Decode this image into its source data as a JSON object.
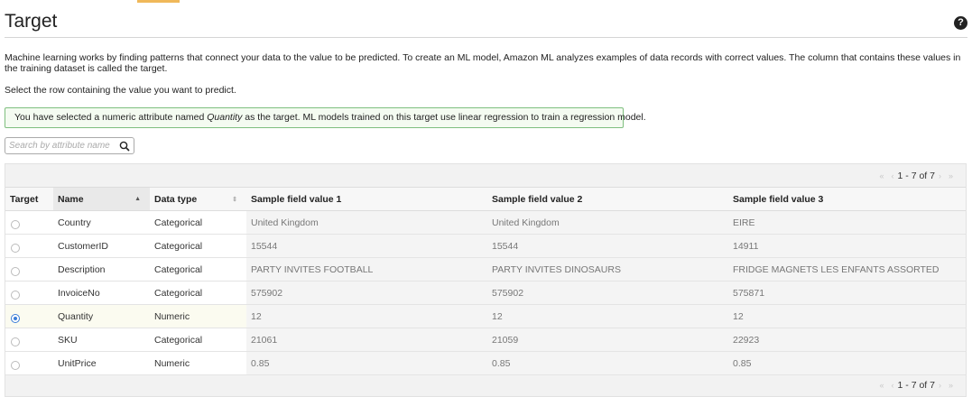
{
  "page": {
    "title": "Target",
    "description": "Machine learning works by finding patterns that connect your data to the value to be predicted. To create an ML model, Amazon ML analyzes examples of data records with correct values. The column that contains these values in the training dataset is called the target.",
    "instruction": "Select the row containing the value you want to predict."
  },
  "alert": {
    "prefix": "You have selected a numeric attribute named ",
    "attribute": "Quantity",
    "suffix": " as the target. ML models trained on this target use linear regression to train a regression model."
  },
  "search": {
    "placeholder": "Search by attribute name"
  },
  "pagination": {
    "range": "1 - 7 of 7"
  },
  "table": {
    "headers": {
      "target": "Target",
      "name": "Name",
      "data_type": "Data type",
      "sample1": "Sample field value 1",
      "sample2": "Sample field value 2",
      "sample3": "Sample field value 3"
    },
    "rows": [
      {
        "name": "Country",
        "data_type": "Categorical",
        "s1": "United Kingdom",
        "s2": "United Kingdom",
        "s3": "EIRE",
        "selected": false
      },
      {
        "name": "CustomerID",
        "data_type": "Categorical",
        "s1": "15544",
        "s2": "15544",
        "s3": "14911",
        "selected": false
      },
      {
        "name": "Description",
        "data_type": "Categorical",
        "s1": "PARTY INVITES FOOTBALL",
        "s2": "PARTY INVITES DINOSAURS",
        "s3": "FRIDGE MAGNETS LES ENFANTS ASSORTED",
        "selected": false
      },
      {
        "name": "InvoiceNo",
        "data_type": "Categorical",
        "s1": "575902",
        "s2": "575902",
        "s3": "575871",
        "selected": false
      },
      {
        "name": "Quantity",
        "data_type": "Numeric",
        "s1": "12",
        "s2": "12",
        "s3": "12",
        "selected": true
      },
      {
        "name": "SKU",
        "data_type": "Categorical",
        "s1": "21061",
        "s2": "21059",
        "s3": "22923",
        "selected": false
      },
      {
        "name": "UnitPrice",
        "data_type": "Numeric",
        "s1": "0.85",
        "s2": "0.85",
        "s3": "0.85",
        "selected": false
      }
    ]
  },
  "icons": {
    "help": "question-circle-icon",
    "search": "magnifier-icon"
  },
  "colors": {
    "accent": "#f0b85a",
    "alert_border": "#7fbf7f",
    "radio_selected": "#3b7dd8"
  }
}
